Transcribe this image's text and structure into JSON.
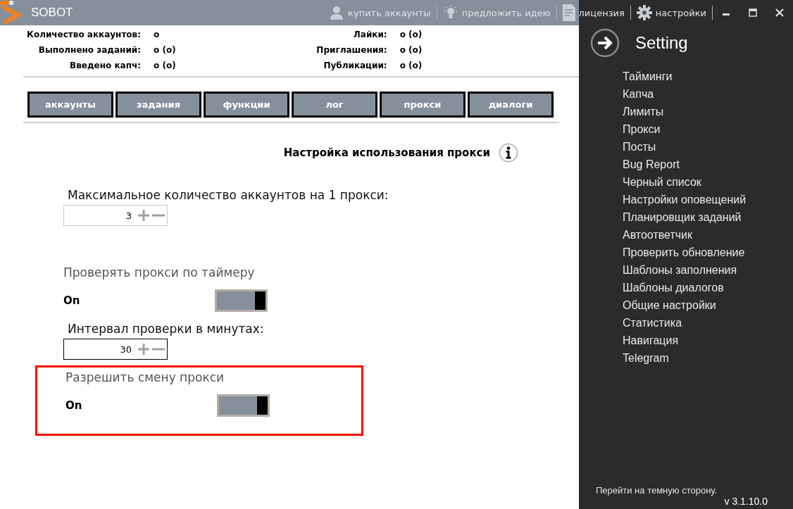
{
  "window": {
    "title": "SOBOT",
    "toolbar": [
      {
        "kind": "user",
        "label": "купить аккаунты"
      },
      {
        "kind": "bulb",
        "label": "предложить идею"
      },
      {
        "kind": "document",
        "label": "лицензия"
      },
      {
        "kind": "gear",
        "label": "настройки"
      }
    ]
  },
  "stats": {
    "left": [
      {
        "label": "Количество аккаунтов:",
        "value": "o"
      },
      {
        "label": "Выполнено заданий:",
        "value": "o (o)"
      },
      {
        "label": "Введено капч:",
        "value": "o (o)"
      }
    ],
    "right": [
      {
        "label": "Лайки:",
        "value": "o (o)"
      },
      {
        "label": "Приглашения:",
        "value": "o (o)"
      },
      {
        "label": "Публикации:",
        "value": "o (o)"
      }
    ]
  },
  "tabs": [
    {
      "label": "аккаунты",
      "selected": false
    },
    {
      "label": "задания",
      "selected": false
    },
    {
      "label": "функции",
      "selected": false
    },
    {
      "label": "лог",
      "selected": false
    },
    {
      "label": "прокси",
      "selected": false
    },
    {
      "label": "диалоги",
      "selected": false
    }
  ],
  "content": {
    "heading": "Настройка использования прокси",
    "settings": [
      {
        "kind": "number",
        "label": "Максимальное количество аккаунтов на 1 прокси:",
        "value": "3",
        "focused": false
      },
      {
        "kind": "toggle",
        "label": "Проверять прокси по таймеру",
        "state": "On",
        "on": true,
        "highlighted": false
      },
      {
        "kind": "number",
        "label": "Интервал проверки в минутах:",
        "value": "30",
        "focused": true
      },
      {
        "kind": "toggle",
        "label": "Разрешить смену прокси",
        "state": "On",
        "on": true,
        "highlighted": true
      }
    ]
  },
  "panel": {
    "title": "Setting",
    "items": [
      "Тайминги",
      "Капча",
      "Лимиты",
      "Прокси",
      "Посты",
      "Bug Report",
      "Черный список",
      "Настройки оповещений",
      "Планировщик заданий",
      "Автоответчик",
      "Проверить обновление",
      "Шаблоны заполнения",
      "Шаблоны диалогов",
      "Общие настройки",
      "Статистика",
      "Навигация",
      "Telegram"
    ],
    "footer": "Перейти на темную сторону.",
    "version": "v 3.1.10.0"
  }
}
